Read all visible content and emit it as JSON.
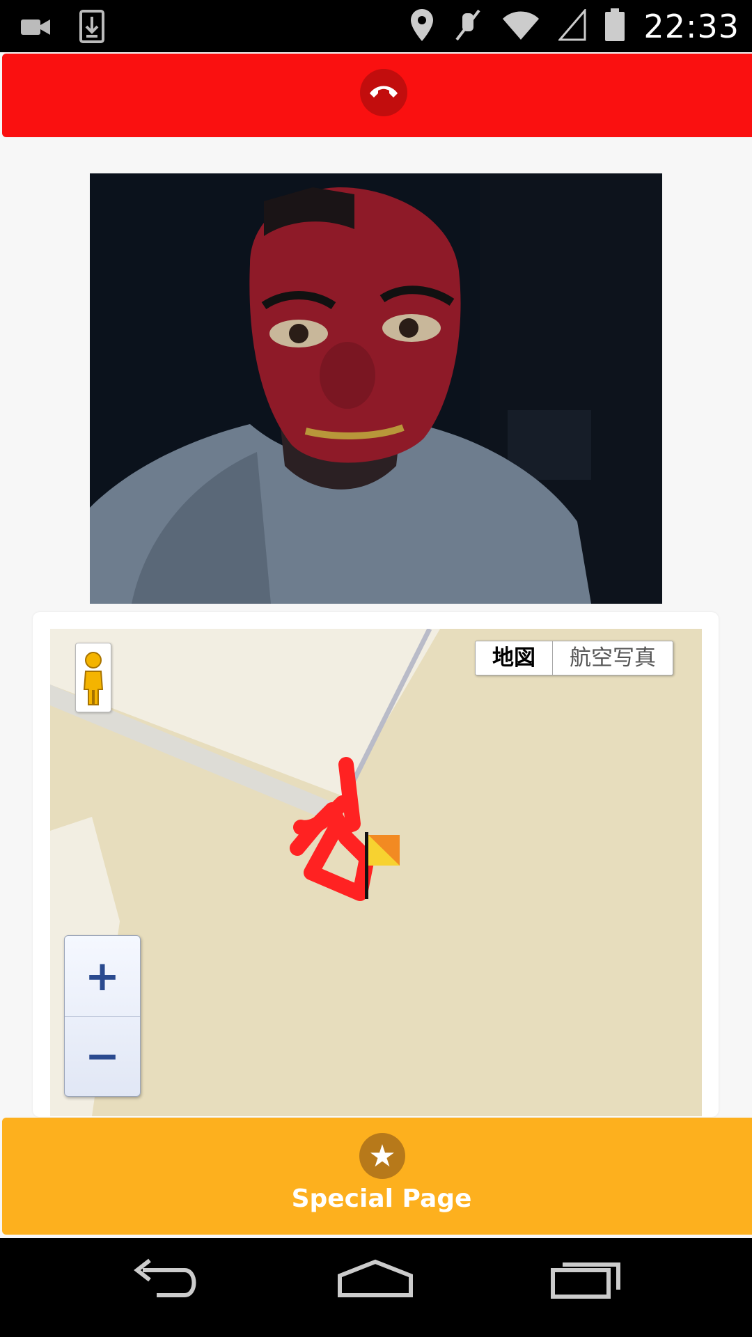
{
  "status_bar": {
    "time": "22:33",
    "icons": [
      "video-call-icon",
      "download-icon",
      "location-icon",
      "mute-icon",
      "wifi-icon",
      "signal-icon",
      "battery-icon"
    ]
  },
  "call_bar": {
    "color": "#fa1010",
    "icon": "hangup-phone-icon"
  },
  "video": {
    "description_icon": "remote-video-feed"
  },
  "map": {
    "map_type_buttons": [
      "地図",
      "航空写真"
    ],
    "selected_map_type": "地図",
    "zoom_in_label": "+",
    "zoom_out_label": "−",
    "icons": [
      "pegman-icon",
      "flag-marker-icon"
    ]
  },
  "special_button": {
    "label": "Special Page",
    "icon": "star-icon",
    "color": "#fdb01e"
  },
  "nav_bar": {
    "icons": [
      "back-icon",
      "home-icon",
      "recents-icon"
    ]
  }
}
